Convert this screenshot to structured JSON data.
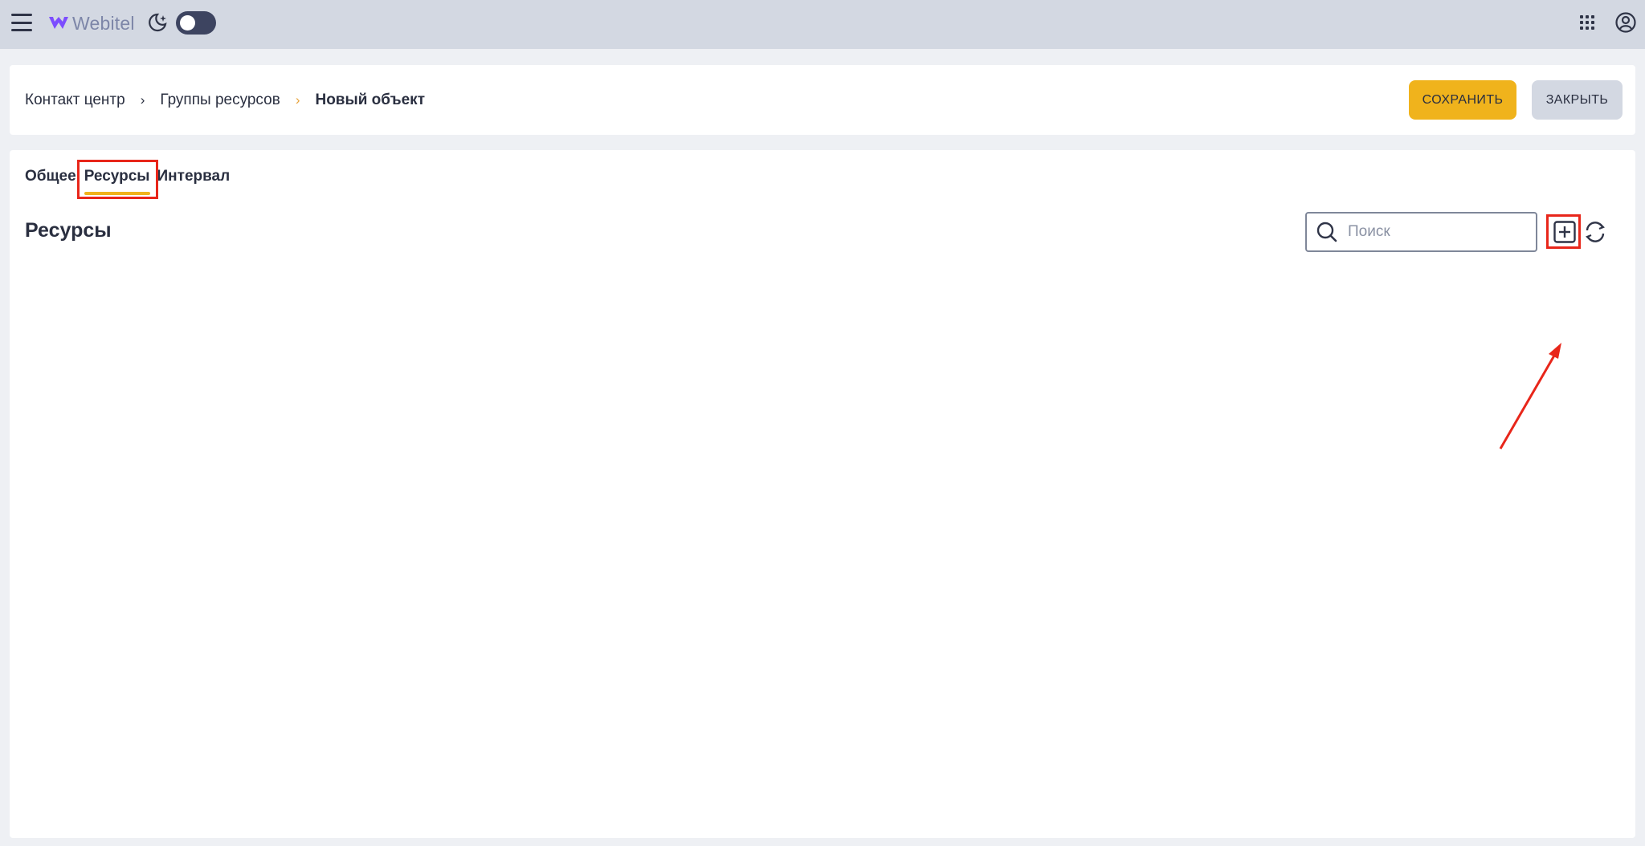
{
  "topbar": {
    "logo_text": "Webitel",
    "logo_color": "#7c4dff",
    "theme_toggle_state": "off"
  },
  "breadcrumb": {
    "items": [
      "Контакт центр",
      "Группы ресурсов"
    ],
    "current": "Новый объект"
  },
  "actions": {
    "save_label": "СОХРАНИТЬ",
    "close_label": "ЗАКРЫТЬ"
  },
  "tabs": [
    {
      "label": "Общее",
      "active": false
    },
    {
      "label": "Ресурсы",
      "active": true
    },
    {
      "label": "Интервал",
      "active": false
    }
  ],
  "section": {
    "title": "Ресурсы",
    "search_placeholder": "Поиск",
    "search_value": ""
  },
  "colors": {
    "accent": "#f0b31c",
    "highlight": "#e8261a",
    "topbar_bg": "#d3d8e2"
  },
  "icons": [
    "hamburger-icon",
    "moon-icon",
    "apps-grid-icon",
    "user-account-icon",
    "search-icon",
    "add-icon",
    "refresh-icon"
  ]
}
